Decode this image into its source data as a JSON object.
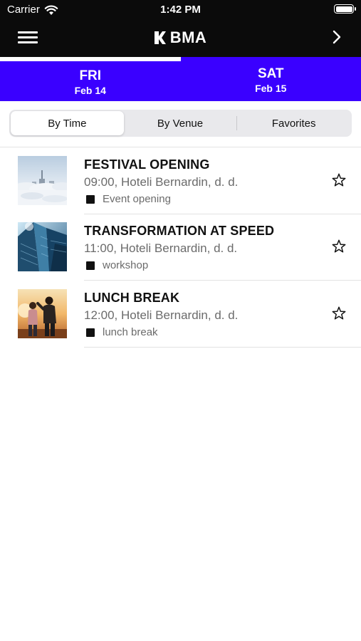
{
  "status": {
    "carrier": "Carrier",
    "time": "1:42 PM"
  },
  "nav": {
    "logo_text": "BMA"
  },
  "colors": {
    "accent": "#3a00ff",
    "topbar": "#0b0b0b"
  },
  "days": [
    {
      "dow": "FRI",
      "date": "Feb 14",
      "active": true
    },
    {
      "dow": "SAT",
      "date": "Feb 15",
      "active": false
    }
  ],
  "segments": {
    "selected": "By Time",
    "items": [
      "By Time",
      "By Venue",
      "Favorites"
    ]
  },
  "events": [
    {
      "title": "FESTIVAL OPENING",
      "meta": "09:00, Hoteli Bernardin, d. d.",
      "tag": "Event opening",
      "favorite": false,
      "thumb": "city-in-clouds"
    },
    {
      "title": "TRANSFORMATION AT SPEED",
      "meta": "11:00, Hoteli Bernardin, d. d.",
      "tag": "workshop",
      "favorite": false,
      "thumb": "glass-skyscrapers"
    },
    {
      "title": "LUNCH BREAK",
      "meta": "12:00, Hoteli Bernardin, d. d.",
      "tag": "lunch break",
      "favorite": false,
      "thumb": "people-at-sunset"
    }
  ]
}
